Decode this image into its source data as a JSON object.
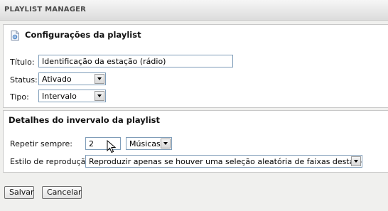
{
  "window": {
    "title": "PLAYLIST MANAGER"
  },
  "settings": {
    "title": "Configurações da playlist",
    "titulo_label": "Título:",
    "titulo_value": "Identificação da estação (rádio)",
    "status_label": "Status:",
    "status_value": "Ativado",
    "tipo_label": "Tipo:",
    "tipo_value": "Intervalo"
  },
  "interval": {
    "title": "Detalhes do invervalo da playlist",
    "repeat_label": "Repetir sempre:",
    "repeat_value": "2",
    "unit_value": "Músicas",
    "style_label": "Estilo de reprodução:",
    "style_value": "Reproduzir apenas se houver uma seleção aleatória de faixas desta playlist"
  },
  "actions": {
    "save_label": "Salvar",
    "cancel_label": "Cancelar"
  }
}
